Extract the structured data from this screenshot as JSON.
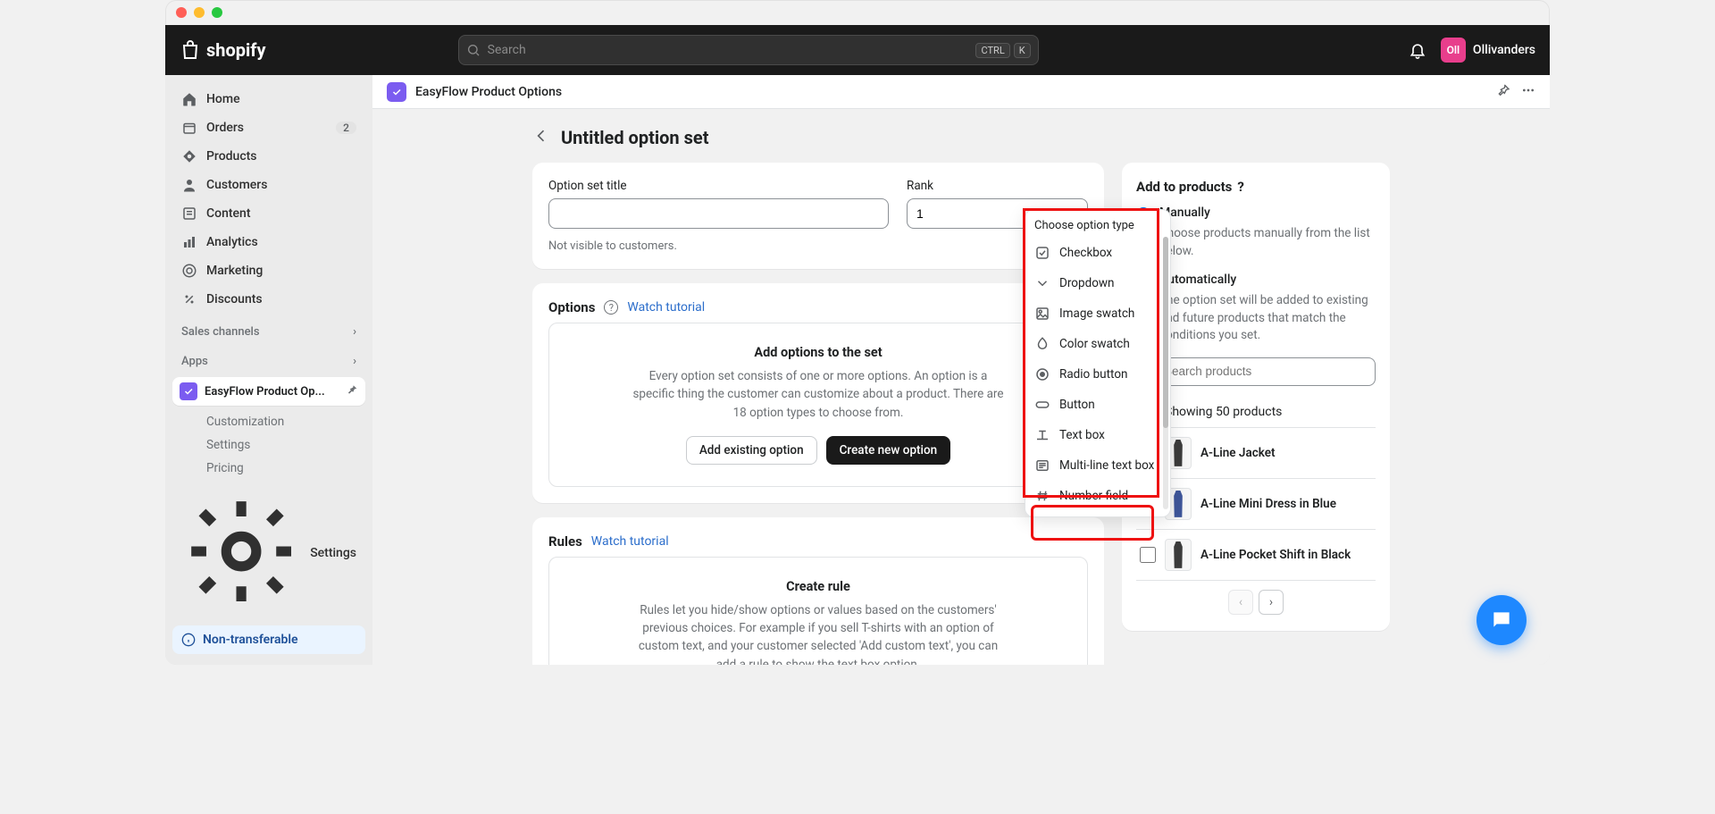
{
  "topbar": {
    "brand": "shopify",
    "search_placeholder": "Search",
    "kbd_ctrl": "CTRL",
    "kbd_k": "K",
    "avatar_initials": "Oll",
    "user_name": "Ollivanders"
  },
  "nav": {
    "home": "Home",
    "orders": "Orders",
    "orders_badge": "2",
    "products": "Products",
    "customers": "Customers",
    "content": "Content",
    "analytics": "Analytics",
    "marketing": "Marketing",
    "discounts": "Discounts",
    "sales_channels": "Sales channels",
    "apps": "Apps",
    "pinned_app": "EasyFlow Product Op...",
    "sub": {
      "customization": "Customization",
      "settings": "Settings",
      "pricing": "Pricing"
    },
    "settings": "Settings",
    "non_transferable": "Non-transferable"
  },
  "header": {
    "app_name": "EasyFlow Product Options"
  },
  "page": {
    "title": "Untitled option set"
  },
  "option_set_card": {
    "title_label": "Option set title",
    "title_value": "",
    "rank_label": "Rank",
    "rank_value": "1",
    "help": "Not visible to customers."
  },
  "options_card": {
    "heading": "Options",
    "tutorial": "Watch tutorial",
    "panel_title": "Add options to the set",
    "panel_desc": "Every option set consists of one or more options. An option is a specific thing the customer can customize about a product. There are 18 option types to choose from.",
    "add_existing": "Add existing option",
    "create_new": "Create new option"
  },
  "popover": {
    "title": "Choose option type",
    "items": [
      "Checkbox",
      "Dropdown",
      "Image swatch",
      "Color swatch",
      "Radio button",
      "Button",
      "Text box",
      "Multi-line text box",
      "Number field"
    ]
  },
  "rules_card": {
    "heading": "Rules",
    "tutorial": "Watch tutorial",
    "panel_title": "Create rule",
    "panel_desc": "Rules let you hide/show options or values based on the customers' previous choices. For example if you sell T-shirts with an option of custom text, and your customer selected 'Add custom text', you can add a rule to show the text box option."
  },
  "add_products": {
    "heading": "Add to products",
    "manual_label": "Manually",
    "manual_desc": "Choose products manually from the list below.",
    "auto_label": "Automatically",
    "auto_desc": "The option set will be added to existing and future products that match the conditions you set.",
    "search_placeholder": "Search products",
    "showing": "Showing 50 products",
    "products": [
      {
        "name": "A-Line Jacket",
        "variant": "black"
      },
      {
        "name": "A-Line Mini Dress in Blue",
        "variant": "blue"
      },
      {
        "name": "A-Line Pocket Shift in Black",
        "variant": "black"
      }
    ]
  }
}
